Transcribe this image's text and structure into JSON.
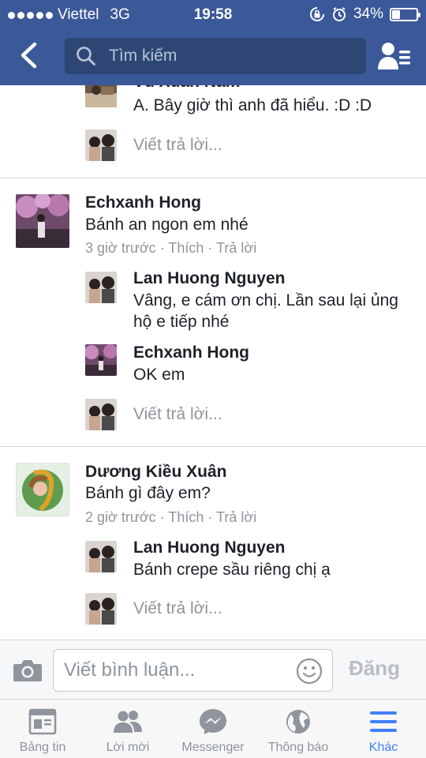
{
  "status_bar": {
    "carrier": "Viettel",
    "network": "3G",
    "time": "19:58",
    "battery_percent": "34%",
    "battery_level": 0.34
  },
  "header": {
    "search_placeholder": "Tìm kiếm"
  },
  "comments": [
    {
      "author": "Vũ Xuân Nam",
      "text": "A. Bây giờ thì anh đã hiểu. :D :D",
      "reply_prompt": "Viết trả lời..."
    },
    {
      "author": "Echxanh Hong",
      "text": "Bánh an ngon em nhé",
      "time": "3 giờ trước",
      "like": "Thích",
      "reply": "Trả lời",
      "replies": [
        {
          "author": "Lan Huong Nguyen",
          "text": "Vâng, e cám ơn chị. Lần sau lại ủng hộ e tiếp nhé"
        },
        {
          "author": "Echxanh Hong",
          "text": "OK em"
        }
      ],
      "reply_prompt": "Viết trả lời..."
    },
    {
      "author": "Dương Kiều Xuân",
      "text": "Bánh gì đây em?",
      "time": "2 giờ trước",
      "like": "Thích",
      "reply": "Trả lời",
      "replies": [
        {
          "author": "Lan Huong Nguyen",
          "text": "Bánh crepe sầu riêng chị ạ"
        }
      ],
      "reply_prompt": "Viết trả lời..."
    }
  ],
  "composer": {
    "placeholder": "Viết bình luận...",
    "post_label": "Đăng"
  },
  "tabs": [
    {
      "label": "Bảng tin",
      "icon": "news-feed-icon",
      "active": false
    },
    {
      "label": "Lời mời",
      "icon": "friend-requests-icon",
      "active": false
    },
    {
      "label": "Messenger",
      "icon": "messenger-icon",
      "active": false
    },
    {
      "label": "Thông báo",
      "icon": "globe-icon",
      "active": false
    },
    {
      "label": "Khác",
      "icon": "menu-icon",
      "active": true
    }
  ],
  "colors": {
    "header_bg": "#3b5998",
    "search_bg": "#2d4673",
    "active_tab": "#4080ff",
    "muted_text": "#90949c"
  }
}
